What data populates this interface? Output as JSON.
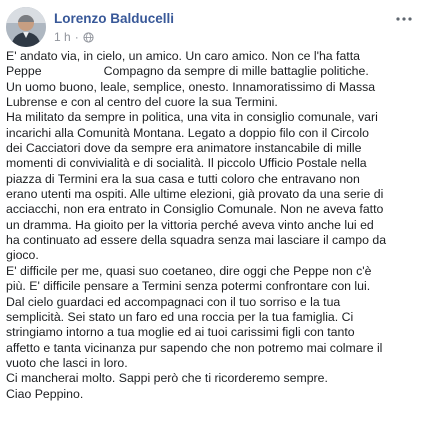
{
  "post": {
    "author": "Lorenzo Balducelli",
    "time": "1 h",
    "separator": "·",
    "privacy_icon": "globe-icon",
    "more_icon": "more-options-icon",
    "lines": [
      "E' andato via, in cielo, un amico. Un caro amico. Non ce l'ha fatta",
      {
        "before": "Peppe",
        "after": "Compagno da sempre di mille battaglie politiche."
      },
      "Un uomo buono, leale, semplice, onesto. Innamoratissimo di Massa",
      "Lubrense e con al centro del cuore la sua Termini.",
      "Ha militato da sempre in politica, una vita in consiglio comunale, vari",
      "incarichi alla Comunità Montana. Legato a doppio filo con il Circolo",
      "dei Cacciatori dove da sempre era animatore instancabile di mille",
      "momenti di convivialità e di socialità. Il piccolo Ufficio Postale nella",
      "piazza di Termini era la sua casa e tutti coloro che entravano non",
      "erano utenti ma ospiti. Alle ultime elezioni, già provato da una serie di",
      "acciacchi, non era entrato in Consiglio Comunale. Non ne aveva fatto",
      "un dramma. Ha gioito per la vittoria perché aveva vinto anche lui ed",
      "ha continuato ad essere della squadra senza mai lasciare il campo da",
      "gioco.",
      "E' difficile per me, quasi suo coetaneo, dire oggi che Peppe non c'è",
      "più.  E' difficile pensare a Termini senza potermi confrontare con lui.",
      "Dal cielo guardaci ed accompagnaci con il tuo sorriso e la tua",
      "semplicità. Sei stato un faro ed una roccia per la tua famiglia. Ci",
      "stringiamo intorno a tua moglie ed ai tuoi carissimi figli con tanto",
      "affetto e tanta vicinanza pur sapendo che non potremo mai colmare il",
      "vuoto che lasci in loro.",
      "Ci mancherai molto. Sappi però che ti ricorderemo sempre.",
      "Ciao Peppino."
    ]
  }
}
